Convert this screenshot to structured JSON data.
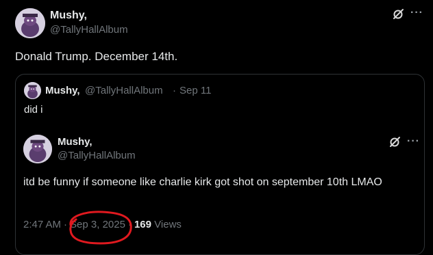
{
  "post": {
    "author_name": "Mushy,",
    "author_handle": "@TallyHallAlbum",
    "text": "Donald Trump. December 14th.",
    "more_label": "···"
  },
  "quote": {
    "author_name": "Mushy,",
    "author_handle": "@TallyHallAlbum",
    "separator": "·",
    "date": "Sep 11",
    "text": "did i"
  },
  "inner": {
    "author_name": "Mushy,",
    "author_handle": "@TallyHallAlbum",
    "text": "itd be funny if someone like charlie kirk got shot on september 10th LMAO",
    "more_label": "···",
    "time": "2:47 AM",
    "separator": "·",
    "date": "Sep 3, 2025",
    "views_count": "169",
    "views_label": "Views"
  },
  "colors": {
    "background": "#000000",
    "text": "#e7e9ea",
    "muted": "#71767b",
    "annotation_circle": "#e0191f"
  },
  "icons": {
    "grok": "grok-icon",
    "more": "more-icon",
    "avatar": "avatar-image"
  }
}
